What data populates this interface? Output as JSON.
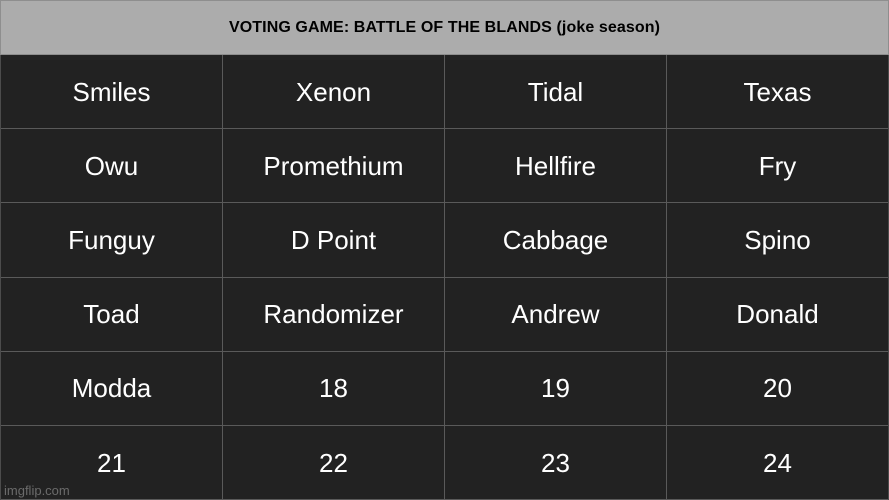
{
  "meme": {
    "title": "VOTING GAME: BATTLE OF THE BLANDS (joke season)",
    "watermark": "imgflip.com",
    "colors": {
      "title_bar_background": "#acacac",
      "title_text": "#000000",
      "cell_background": "#222222",
      "cell_text": "#ffffff",
      "grid_line": "#5a5a5a",
      "watermark_text": "#6f6f6f"
    },
    "grid": {
      "columns": 4,
      "rows": 6,
      "cells": [
        [
          "Smiles",
          "Xenon",
          "Tidal",
          "Texas"
        ],
        [
          "Owu",
          "Promethium",
          "Hellfire",
          "Fry"
        ],
        [
          "Funguy",
          "D Point",
          "Cabbage",
          "Spino"
        ],
        [
          "Toad",
          "Randomizer",
          "Andrew",
          "Donald"
        ],
        [
          "Modda",
          "18",
          "19",
          "20"
        ],
        [
          "21",
          "22",
          "23",
          "24"
        ]
      ]
    }
  }
}
